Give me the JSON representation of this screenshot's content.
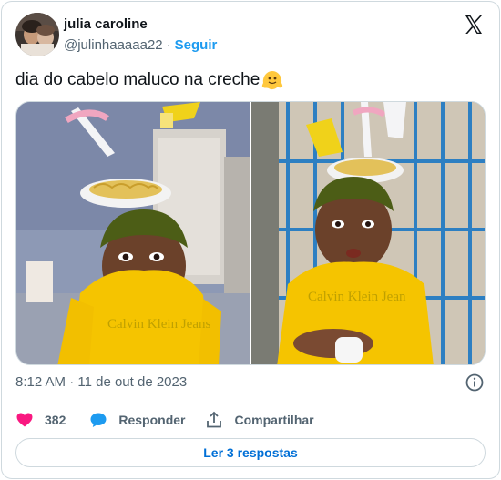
{
  "author": {
    "name": "julia caroline",
    "handle": "@julinhaaaaa22",
    "separator": "·",
    "follow_label": "Seguir"
  },
  "tweet": {
    "text": "dia do cabelo maluco na creche",
    "emoji": "melting-face-emoji"
  },
  "media": {
    "count": 2,
    "shirt_text": "Calvin Klein Jeans",
    "shirt_text_right": "Calvin Klein Jean"
  },
  "meta": {
    "timestamp": "8:12 AM · 11 de out de 2023"
  },
  "actions": {
    "like_count": "382",
    "reply_label": "Responder",
    "share_label": "Compartilhar"
  },
  "footer": {
    "read_replies_label": "Ler 3 respostas"
  },
  "icons": [
    "x-logo-icon",
    "info-icon",
    "heart-icon",
    "reply-bubble-icon",
    "share-icon"
  ],
  "colors": {
    "accent": "#1d9bf0",
    "link": "#006fd6",
    "like": "#f91880",
    "muted": "#536471",
    "border": "#cfd9de",
    "shirt": "#f5c400",
    "noodles": "#e8c24a"
  }
}
